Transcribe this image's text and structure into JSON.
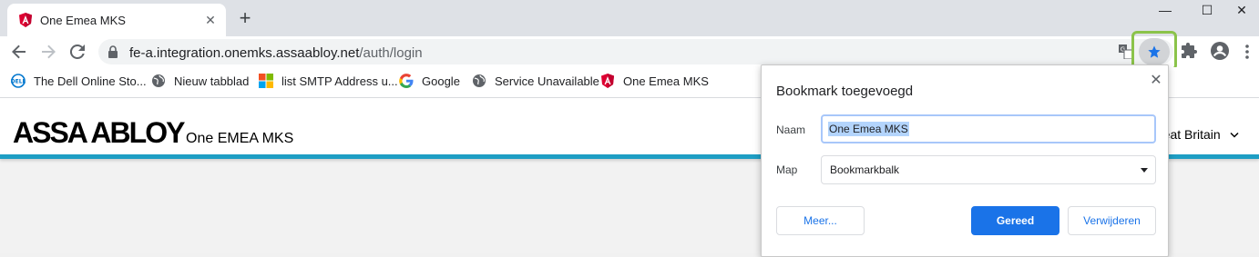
{
  "browser": {
    "tab": {
      "title": "One Emea MKS",
      "close": "✕",
      "favicon": "angular-icon"
    },
    "new_tab": "+",
    "window_controls": {
      "minimize": "—",
      "maximize": "☐",
      "close": "✕"
    },
    "address": {
      "host": "fe-a.integration.onemks.assaabloy.net",
      "path": "/auth/login"
    },
    "colors": {
      "star_blue": "#1a73e8",
      "highlight_green": "#8bc34a",
      "header_accent": "#1e9ec4"
    }
  },
  "bookmarks": [
    {
      "label": "The Dell Online Sto...",
      "icon": "dell-icon"
    },
    {
      "label": "Nieuw tabblad",
      "icon": "globe-icon"
    },
    {
      "label": "list SMTP Address u...",
      "icon": "microsoft-icon"
    },
    {
      "label": "Google",
      "icon": "google-icon"
    },
    {
      "label": "Service Unavailable",
      "icon": "globe-icon"
    },
    {
      "label": "One Emea MKS",
      "icon": "angular-icon"
    }
  ],
  "site": {
    "logo": "ASSA ABLOY",
    "name": "One EMEA MKS",
    "region": "reat Britain"
  },
  "dialog": {
    "title": "Bookmark toegevoegd",
    "close": "✕",
    "name_label": "Naam",
    "name_value": "One Emea MKS",
    "folder_label": "Map",
    "folder_value": "Bookmarkbalk",
    "more_button": "Meer...",
    "done_button": "Gereed",
    "remove_button": "Verwijderen"
  }
}
